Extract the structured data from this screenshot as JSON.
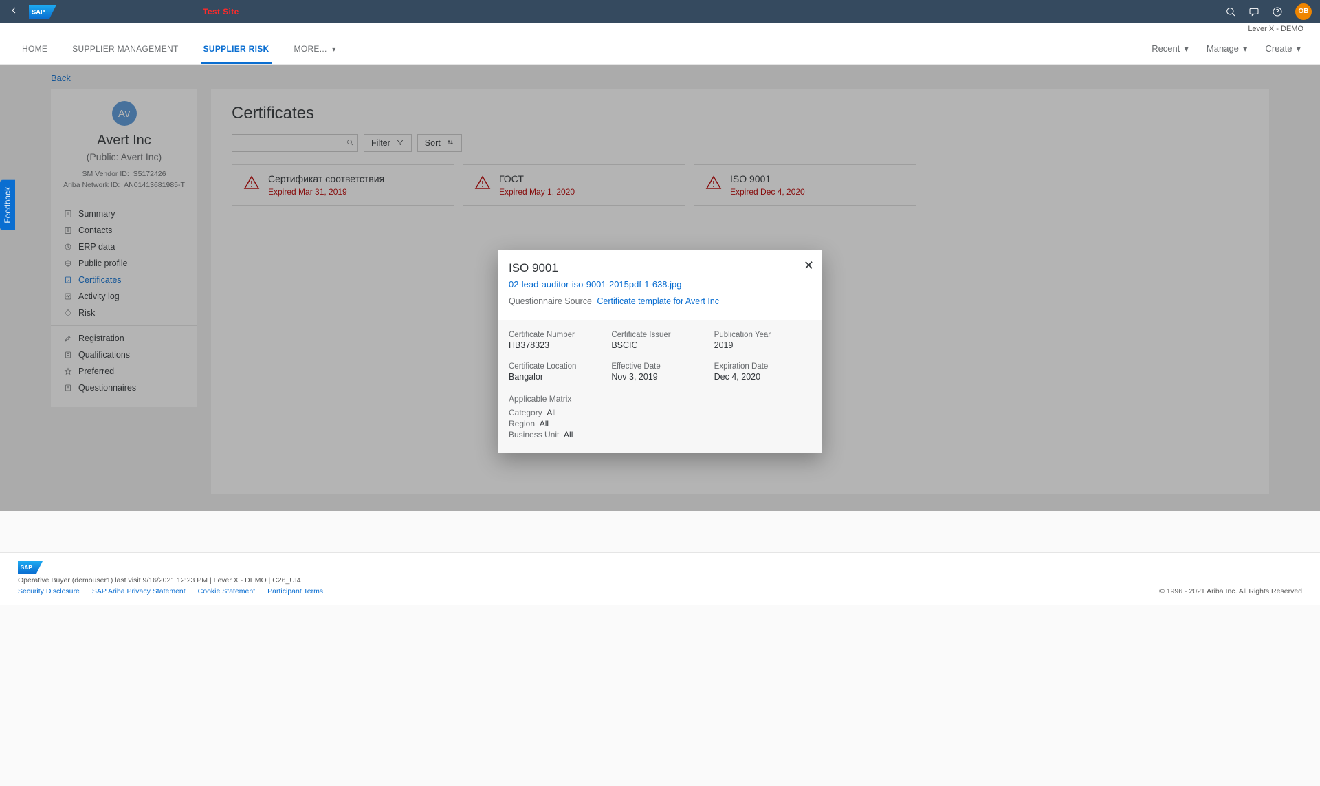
{
  "shell": {
    "test_site_label": "Test Site",
    "avatar_initials": "OB",
    "realm": "Lever X - DEMO"
  },
  "tabs": {
    "items": [
      "HOME",
      "SUPPLIER MANAGEMENT",
      "SUPPLIER RISK",
      "MORE..."
    ],
    "active_index": 2,
    "right_menus": [
      "Recent",
      "Manage",
      "Create"
    ]
  },
  "back_label": "Back",
  "supplier": {
    "avatar_initials": "Av",
    "name": "Avert Inc",
    "public_name": "(Public: Avert Inc)",
    "id_labels": {
      "vendor": "SM Vendor ID:",
      "network": "Ariba Network ID:"
    },
    "vendor_id": "S5172426",
    "network_id": "AN01413681985-T",
    "nav_primary": [
      "Summary",
      "Contacts",
      "ERP data",
      "Public profile",
      "Certificates",
      "Activity log",
      "Risk"
    ],
    "nav_primary_active_index": 4,
    "nav_secondary": [
      "Registration",
      "Qualifications",
      "Preferred",
      "Questionnaires"
    ]
  },
  "certificates": {
    "title": "Certificates",
    "filter_label": "Filter",
    "sort_label": "Sort",
    "cards": [
      {
        "title": "Сертификат соответствия",
        "status": "Expired Mar 31, 2019"
      },
      {
        "title": "ГОСТ",
        "status": "Expired May 1, 2020"
      },
      {
        "title": "ISO 9001",
        "status": "Expired Dec 4, 2020"
      }
    ]
  },
  "dialog": {
    "title": "ISO 9001",
    "attachment": "02-lead-auditor-iso-9001-2015pdf-1-638.jpg",
    "questionnaire_label": "Questionnaire Source",
    "questionnaire_link": "Certificate template for Avert Inc",
    "fields": {
      "cert_number": {
        "label": "Certificate Number",
        "value": "HB378323"
      },
      "issuer": {
        "label": "Certificate Issuer",
        "value": "BSCIC"
      },
      "pub_year": {
        "label": "Publication Year",
        "value": "2019"
      },
      "location": {
        "label": "Certificate Location",
        "value": "Bangalor"
      },
      "effective": {
        "label": "Effective Date",
        "value": "Nov 3, 2019"
      },
      "expiration": {
        "label": "Expiration Date",
        "value": "Dec 4, 2020"
      }
    },
    "matrix": {
      "title": "Applicable Matrix",
      "rows": [
        {
          "label": "Category",
          "value": "All"
        },
        {
          "label": "Region",
          "value": "All"
        },
        {
          "label": "Business Unit",
          "value": "All"
        }
      ]
    }
  },
  "feedback_label": "Feedback",
  "footer": {
    "session": "Operative Buyer (demouser1) last visit 9/16/2021 12:23 PM | Lever X - DEMO | C26_UI4",
    "links": [
      "Security Disclosure",
      "SAP Ariba Privacy Statement",
      "Cookie Statement",
      "Participant Terms"
    ],
    "copyright": "© 1996 - 2021 Ariba Inc. All Rights Reserved"
  }
}
